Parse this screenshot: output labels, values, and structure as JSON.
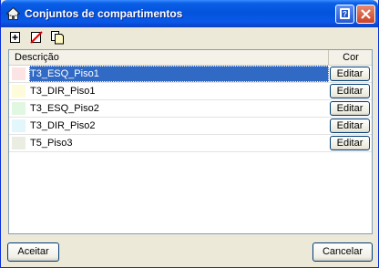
{
  "window": {
    "title": "Conjuntos de compartimentos"
  },
  "toolbar": {
    "icons": [
      "add-icon",
      "delete-icon",
      "copy-icon"
    ]
  },
  "table": {
    "columns": [
      "Descrição",
      "Cor"
    ],
    "rows": [
      {
        "label": "T3_ESQ_Piso1",
        "color": "#FCE4E4",
        "button": "Editar",
        "selected": true
      },
      {
        "label": "T3_DIR_Piso1",
        "color": "#FDFBDA",
        "button": "Editar",
        "selected": false
      },
      {
        "label": "T3_ESQ_Piso2",
        "color": "#E2F7E2",
        "button": "Editar",
        "selected": false
      },
      {
        "label": "T3_DIR_Piso2",
        "color": "#E2F6FC",
        "button": "Editar",
        "selected": false
      },
      {
        "label": "T5_Piso3",
        "color": "#E9EDE2",
        "button": "Editar",
        "selected": false
      }
    ]
  },
  "footer": {
    "ok_label": "Aceitar",
    "cancel_label": "Cancelar"
  },
  "colors": {
    "title_bar": "#0453DC",
    "selection": "#316AC5",
    "background": "#ECE9D8"
  }
}
